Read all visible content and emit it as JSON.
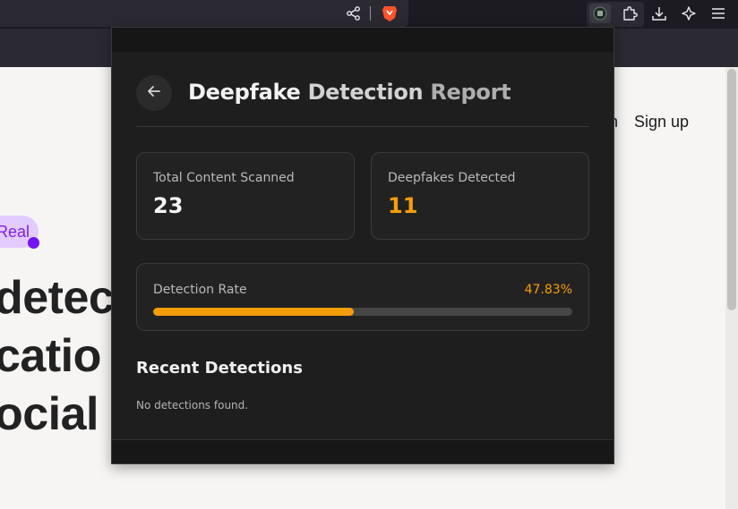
{
  "browser": {
    "icons": [
      "share-icon",
      "brave-shield-icon",
      "extension-active-icon",
      "puzzle-icon",
      "download-icon",
      "leo-ai-icon",
      "menu-icon"
    ]
  },
  "page": {
    "nav": {
      "partial_link": "n",
      "signup": "Sign up"
    },
    "pill": "Real",
    "hero": [
      "detec",
      "catio",
      "ocial n"
    ]
  },
  "popup": {
    "title_part1": "Deepfake",
    "title_part2": "Detection",
    "title_part3": "Report",
    "stats": {
      "total_label": "Total Content Scanned",
      "total_value": "23",
      "deepfakes_label": "Deepfakes Detected",
      "deepfakes_value": "11"
    },
    "rate": {
      "label": "Detection Rate",
      "value_text": "47.83%",
      "fraction": 0.4783
    },
    "recent": {
      "title": "Recent Detections",
      "empty": "No detections found."
    },
    "colors": {
      "accent": "#f59e0b",
      "panel": "#1f1e1e"
    }
  }
}
